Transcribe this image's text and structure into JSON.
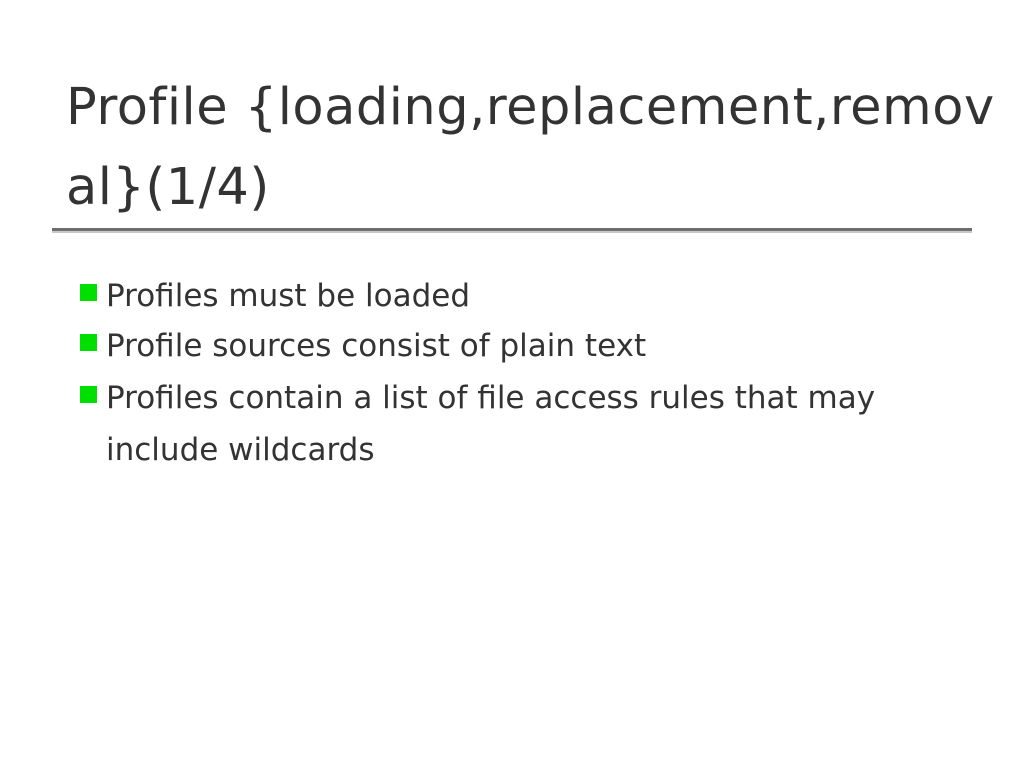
{
  "slide": {
    "title_line1": "Profile {loading,replacement,remov",
    "title_line2": "al}(1/4)",
    "bullets": [
      {
        "text": "Profiles must be loaded"
      },
      {
        "text": "Profile sources consist of plain text"
      },
      {
        "text": "Profiles contain a list of file access rules that may include wildcards"
      }
    ],
    "colors": {
      "bullet_square": "#00e000",
      "text": "#333333",
      "rule": "#6e6e6e"
    },
    "icons": {
      "bullet": "green-square-bullet-icon"
    }
  }
}
